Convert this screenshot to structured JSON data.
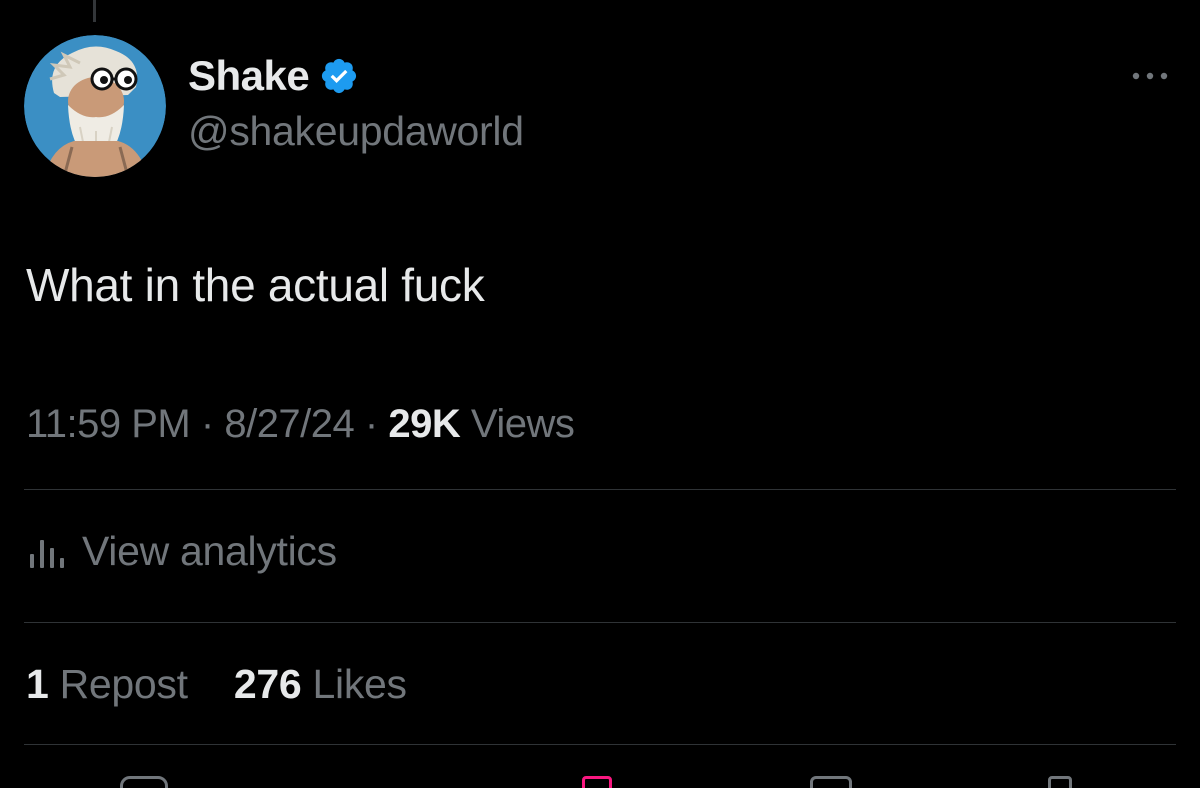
{
  "author": {
    "display_name": "Shake",
    "handle": "@shakeupdaworld",
    "verified": true,
    "avatar": "avatar-illustration"
  },
  "tweet": {
    "text": "What in the actual fuck"
  },
  "meta": {
    "time": "11:59 PM",
    "separator": "·",
    "date": "8/27/24",
    "views_count": "29K",
    "views_label": "Views"
  },
  "analytics": {
    "icon": "bar-chart-icon",
    "label": "View analytics"
  },
  "stats": {
    "reposts_count": "1",
    "reposts_label": "Repost",
    "likes_count": "276",
    "likes_label": "Likes"
  },
  "menu": {
    "icon": "more-options-icon"
  },
  "colors": {
    "background": "#000000",
    "primary_text": "#e7e9ea",
    "secondary_text": "#71767b",
    "divider": "#2f3336",
    "verified_blue": "#1d9bf0"
  }
}
